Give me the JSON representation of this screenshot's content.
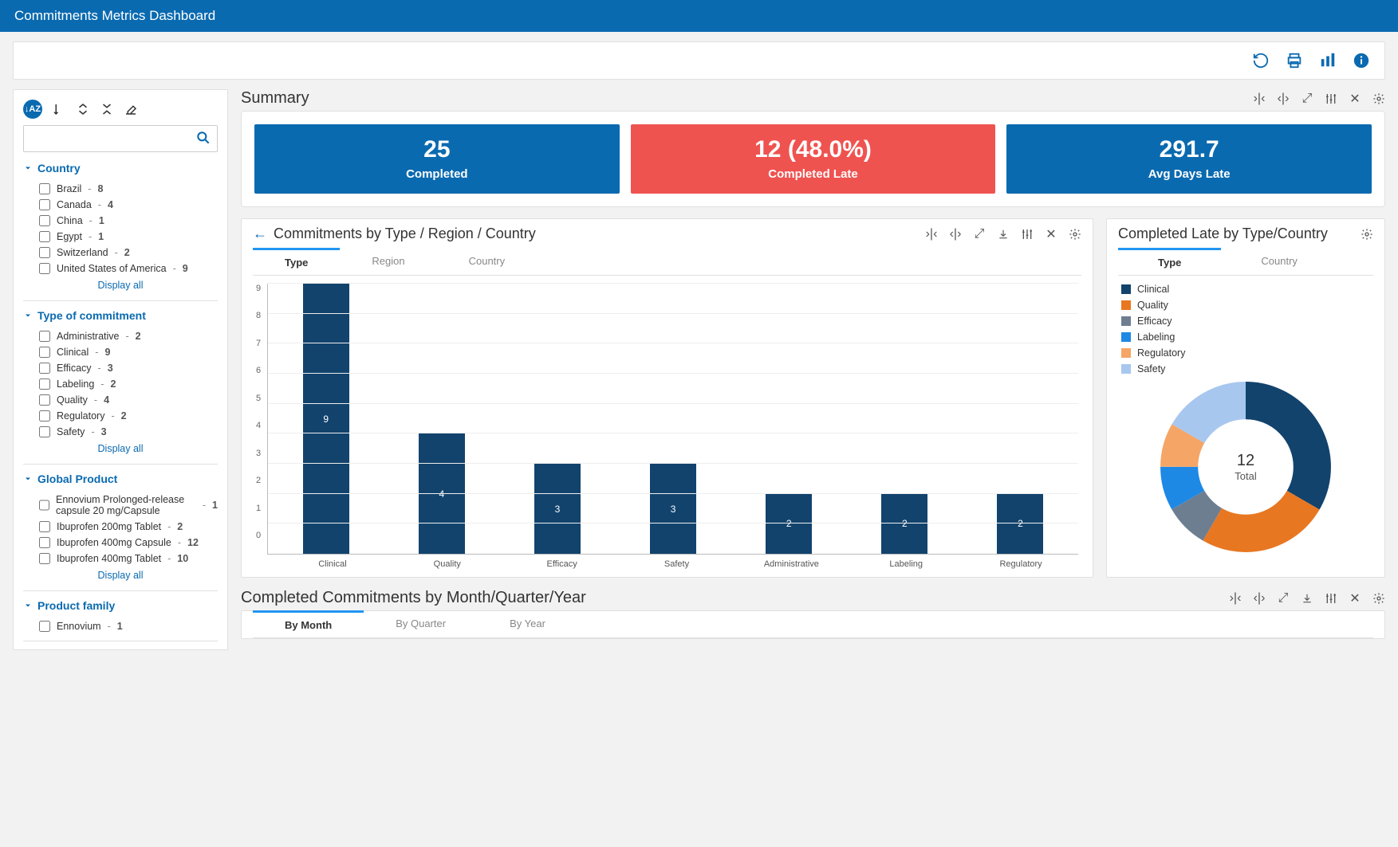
{
  "header": {
    "title": "Commitments Metrics Dashboard"
  },
  "sidebar": {
    "displayAll": "Display all",
    "facets": [
      {
        "title": "Country",
        "items": [
          {
            "label": "Brazil",
            "count": 8
          },
          {
            "label": "Canada",
            "count": 4
          },
          {
            "label": "China",
            "count": 1
          },
          {
            "label": "Egypt",
            "count": 1
          },
          {
            "label": "Switzerland",
            "count": 2
          },
          {
            "label": "United States of America",
            "count": 9
          }
        ],
        "showAll": true
      },
      {
        "title": "Type of commitment",
        "items": [
          {
            "label": "Administrative",
            "count": 2
          },
          {
            "label": "Clinical",
            "count": 9
          },
          {
            "label": "Efficacy",
            "count": 3
          },
          {
            "label": "Labeling",
            "count": 2
          },
          {
            "label": "Quality",
            "count": 4
          },
          {
            "label": "Regulatory",
            "count": 2
          },
          {
            "label": "Safety",
            "count": 3
          }
        ],
        "showAll": true
      },
      {
        "title": "Global Product",
        "items": [
          {
            "label": "Ennovium Prolonged-release capsule 20 mg/Capsule",
            "count": 1
          },
          {
            "label": "Ibuprofen 200mg Tablet",
            "count": 2
          },
          {
            "label": "Ibuprofen 400mg Capsule",
            "count": 12
          },
          {
            "label": "Ibuprofen 400mg Tablet",
            "count": 10
          }
        ],
        "showAll": true
      },
      {
        "title": "Product family",
        "items": [
          {
            "label": "Ennovium",
            "count": 1
          }
        ],
        "showAll": false
      }
    ]
  },
  "summary": {
    "title": "Summary",
    "cards": [
      {
        "value": "25",
        "label": "Completed",
        "color": "blue"
      },
      {
        "value": "12 (48.0%)",
        "label": "Completed Late",
        "color": "red"
      },
      {
        "value": "291.7",
        "label": "Avg Days Late",
        "color": "blue"
      }
    ]
  },
  "byType": {
    "title": "Commitments by Type / Region / Country",
    "tabs": [
      "Type",
      "Region",
      "Country"
    ],
    "activeTab": 0
  },
  "lateByType": {
    "title": "Completed Late by Type/Country",
    "tabs": [
      "Type",
      "Country"
    ],
    "activeTab": 0,
    "legend": [
      {
        "label": "Clinical",
        "color": "#12436d"
      },
      {
        "label": "Quality",
        "color": "#e87722"
      },
      {
        "label": "Efficacy",
        "color": "#6e7e91"
      },
      {
        "label": "Labeling",
        "color": "#1e88e5"
      },
      {
        "label": "Regulatory",
        "color": "#f5a566"
      },
      {
        "label": "Safety",
        "color": "#a7c7ef"
      }
    ],
    "centerValue": "12",
    "centerLabel": "Total"
  },
  "byMonth": {
    "title": "Completed Commitments by Month/Quarter/Year",
    "tabs": [
      "By Month",
      "By Quarter",
      "By Year"
    ],
    "activeTab": 0
  },
  "chart_data": [
    {
      "type": "bar",
      "title": "Commitments by Type",
      "categories": [
        "Clinical",
        "Quality",
        "Efficacy",
        "Safety",
        "Administrative",
        "Labeling",
        "Regulatory"
      ],
      "values": [
        9,
        4,
        3,
        3,
        2,
        2,
        2
      ],
      "xlabel": "",
      "ylabel": "",
      "ylim": [
        0,
        9
      ]
    },
    {
      "type": "pie",
      "title": "Completed Late by Type",
      "categories": [
        "Clinical",
        "Quality",
        "Efficacy",
        "Labeling",
        "Regulatory",
        "Safety"
      ],
      "values": [
        4,
        3,
        1,
        1,
        1,
        2
      ],
      "total": 12
    }
  ]
}
